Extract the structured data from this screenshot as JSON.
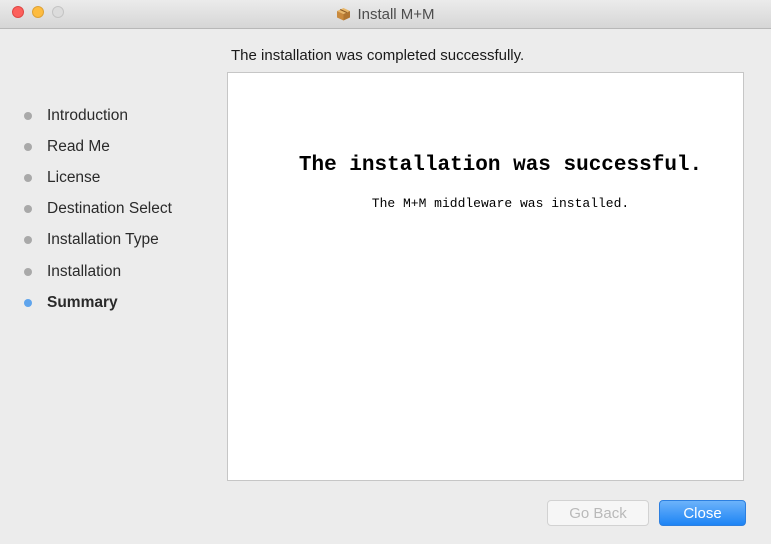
{
  "window": {
    "title": "Install M+M",
    "icon": "package-icon"
  },
  "header": {
    "message": "The installation was completed successfully."
  },
  "sidebar": {
    "steps": [
      {
        "label": "Introduction",
        "current": false
      },
      {
        "label": "Read Me",
        "current": false
      },
      {
        "label": "License",
        "current": false
      },
      {
        "label": "Destination Select",
        "current": false
      },
      {
        "label": "Installation Type",
        "current": false
      },
      {
        "label": "Installation",
        "current": false
      },
      {
        "label": "Summary",
        "current": true
      }
    ]
  },
  "content": {
    "heading": "The installation was successful.",
    "body": "The M+M middleware was installed."
  },
  "buttons": {
    "back_label": "Go Back",
    "back_enabled": false,
    "close_label": "Close"
  },
  "colors": {
    "accent": "#1d84f5",
    "current_step_dot": "#5fa4ec",
    "inactive_step_dot": "#a9a9a9",
    "traffic_close": "#fc605c",
    "traffic_minimize": "#fdbc40",
    "traffic_zoom_disabled": "#dcdcdc"
  }
}
